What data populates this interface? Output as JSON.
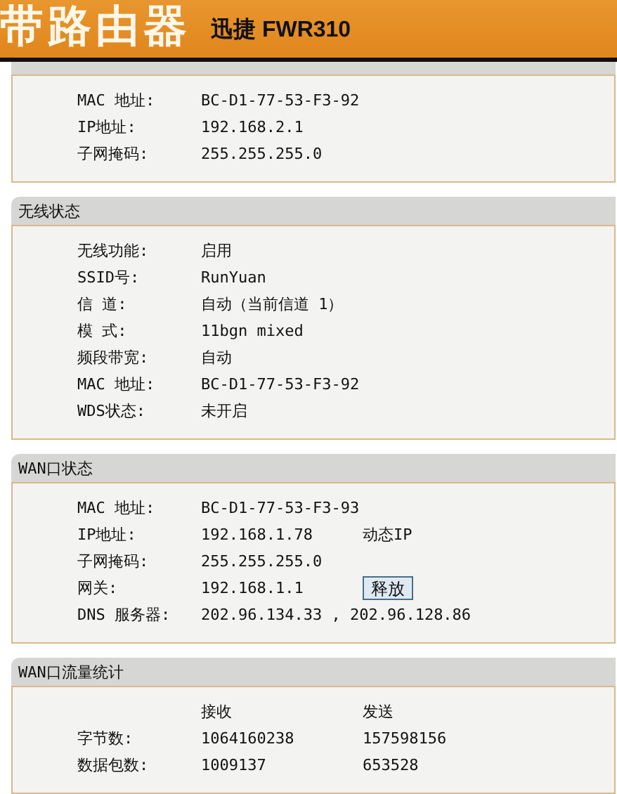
{
  "header": {
    "title": "带路由器",
    "model": "迅捷 FWR310"
  },
  "sections": [
    {
      "kind": "fields",
      "rows": [
        {
          "label": "MAC 地址:",
          "value": "BC-D1-77-53-F3-92"
        },
        {
          "label": "IP地址:",
          "value": "192.168.2.1"
        },
        {
          "label": "子网掩码:",
          "value": "255.255.255.0"
        }
      ]
    },
    {
      "kind": "fields",
      "title": "无线状态",
      "rows": [
        {
          "label": "无线功能:",
          "value": "启用"
        },
        {
          "label": "SSID号:",
          "value": "RunYuan"
        },
        {
          "label": "信 道:",
          "value": "自动（当前信道 1）"
        },
        {
          "label": "模 式:",
          "value": "11bgn mixed"
        },
        {
          "label": "频段带宽:",
          "value": "自动"
        },
        {
          "label": "MAC 地址:",
          "value": "BC-D1-77-53-F3-92"
        },
        {
          "label": "WDS状态:",
          "value": "未开启"
        }
      ]
    },
    {
      "kind": "fields",
      "title": "WAN口状态",
      "rows": [
        {
          "label": "MAC 地址:",
          "value": "BC-D1-77-53-F3-93"
        },
        {
          "label": "IP地址:",
          "value": "192.168.1.78",
          "note": "动态IP"
        },
        {
          "label": "子网掩码:",
          "value": "255.255.255.0"
        },
        {
          "label": "网关:",
          "value": "192.168.1.1",
          "button": "释放"
        },
        {
          "label": "DNS 服务器:",
          "value": "202.96.134.33 , 202.96.128.86"
        }
      ]
    },
    {
      "kind": "stats",
      "title": "WAN口流量统计",
      "columns": [
        "接收",
        "发送"
      ],
      "rows": [
        {
          "label": "字节数:",
          "values": [
            "1064160238",
            "157598156"
          ]
        },
        {
          "label": "数据包数:",
          "values": [
            "1009137",
            "653528"
          ]
        }
      ]
    }
  ]
}
